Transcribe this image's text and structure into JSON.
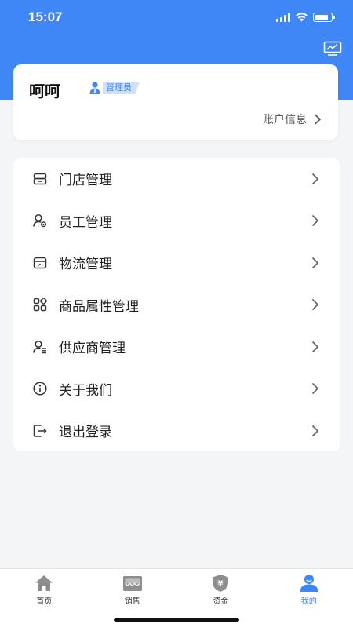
{
  "status_bar": {
    "time": "15:07"
  },
  "profile": {
    "name": "呵呵",
    "role": "管理员",
    "account_link": "账户信息"
  },
  "menu": {
    "items": [
      {
        "label": "门店管理",
        "icon": "store-icon"
      },
      {
        "label": "员工管理",
        "icon": "employee-icon"
      },
      {
        "label": "物流管理",
        "icon": "logistics-icon"
      },
      {
        "label": "商品属性管理",
        "icon": "product-attributes-icon"
      },
      {
        "label": "供应商管理",
        "icon": "supplier-icon"
      },
      {
        "label": "关于我们",
        "icon": "info-icon"
      },
      {
        "label": "退出登录",
        "icon": "logout-icon"
      }
    ]
  },
  "tabbar": {
    "active_index": 3,
    "active_color": "#3f86f6",
    "inactive_color": "#8e8e8e",
    "tabs": [
      {
        "label": "首页",
        "icon": "home-icon"
      },
      {
        "label": "销售",
        "icon": "sales-icon"
      },
      {
        "label": "资金",
        "icon": "funds-icon"
      },
      {
        "label": "我的",
        "icon": "profile-icon"
      }
    ]
  },
  "colors": {
    "primary": "#3f86f6",
    "background": "#f4f5f7"
  }
}
